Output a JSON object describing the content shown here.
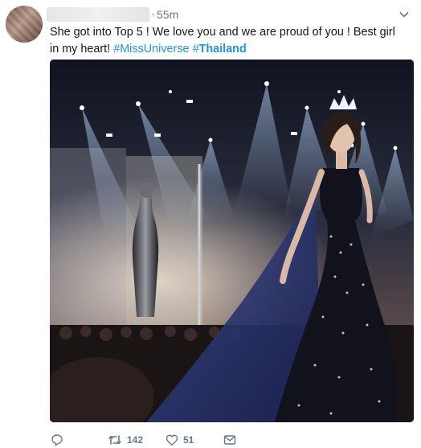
{
  "tweet": {
    "time": "55m",
    "dot": "·",
    "text_main": "She got into Top 5 ! We love you and we are proud of you ! Best girl in my heart! ",
    "hashtag1": "#MissUniverse",
    "hashtag2_prefix": "#",
    "hashtag2_bold": "Thailand",
    "hashtag_color": "#1b95e0"
  },
  "actions": {
    "reply_icon": "reply-icon",
    "retweet_icon": "retweet-icon",
    "retweet_count": "142",
    "like_icon": "heart-icon",
    "like_count": "51",
    "dm_icon": "envelope-icon"
  },
  "media": {
    "icon": "photo",
    "subject": "stage-photo"
  }
}
